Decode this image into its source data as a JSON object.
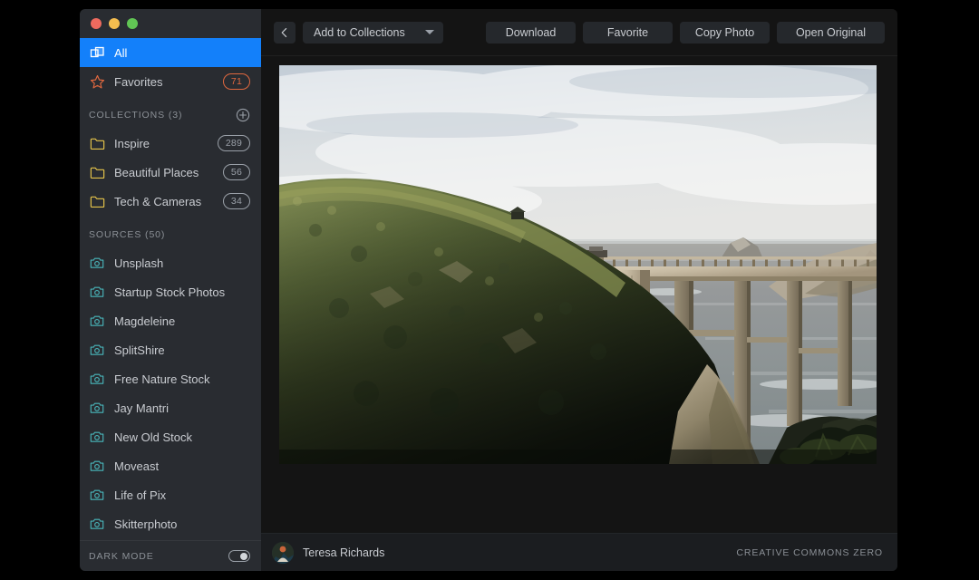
{
  "window": {
    "controls": [
      "close",
      "minimize",
      "zoom"
    ]
  },
  "sidebar": {
    "primary": [
      {
        "label": "All",
        "icon": "stack-icon",
        "selected": true,
        "badge": ""
      },
      {
        "label": "Favorites",
        "icon": "star-icon",
        "selected": false,
        "badge": "71"
      }
    ],
    "collections_header": "COLLECTIONS (3)",
    "add_collection_icon": "plus-circle-icon",
    "collections": [
      {
        "label": "Inspire",
        "icon": "folder-icon",
        "badge": "289"
      },
      {
        "label": "Beautiful Places",
        "icon": "folder-icon",
        "badge": "56"
      },
      {
        "label": "Tech & Cameras",
        "icon": "folder-icon",
        "badge": "34"
      }
    ],
    "sources_header": "SOURCES (50)",
    "sources": [
      {
        "label": "Unsplash",
        "icon": "camera-icon"
      },
      {
        "label": "Startup Stock Photos",
        "icon": "camera-icon"
      },
      {
        "label": "Magdeleine",
        "icon": "camera-icon"
      },
      {
        "label": "SplitShire",
        "icon": "camera-icon"
      },
      {
        "label": "Free Nature Stock",
        "icon": "camera-icon"
      },
      {
        "label": "Jay Mantri",
        "icon": "camera-icon"
      },
      {
        "label": "New Old Stock",
        "icon": "camera-icon"
      },
      {
        "label": "Moveast",
        "icon": "camera-icon"
      },
      {
        "label": "Life of Pix",
        "icon": "camera-icon"
      },
      {
        "label": "Skitterphoto",
        "icon": "camera-icon"
      }
    ],
    "dark_mode_label": "DARK MODE",
    "dark_mode_on": true
  },
  "toolbar": {
    "back_icon": "chevron-left-icon",
    "collections_dropdown": "Add to Collections",
    "dropdown_icon": "caret-down-icon",
    "download": "Download",
    "favorite": "Favorite",
    "copy_photo": "Copy Photo",
    "open_original": "Open Original"
  },
  "photo": {
    "alt": "Bixby Creek Bridge on the Big Sur coastline at golden hour",
    "subject": "coastal-bridge-photograph"
  },
  "statusbar": {
    "author": "Teresa Richards",
    "avatar_icon": "user-avatar",
    "license": "CREATIVE COMMONS ZERO"
  },
  "colors": {
    "accent_selected": "#1380fa",
    "sidebar_bg": "#292c31",
    "main_bg": "#141414",
    "statusbar_bg": "#1b1d20",
    "badge_favorites": "#e0683f",
    "badge_collection": "#9aa0a8",
    "folder_icon": "#e6c44a",
    "camera_icon": "#49b6bb",
    "star_icon": "#e0683f",
    "traffic_red": "#ed6a5e",
    "traffic_yellow": "#f4bd4f",
    "traffic_green": "#61c554"
  }
}
